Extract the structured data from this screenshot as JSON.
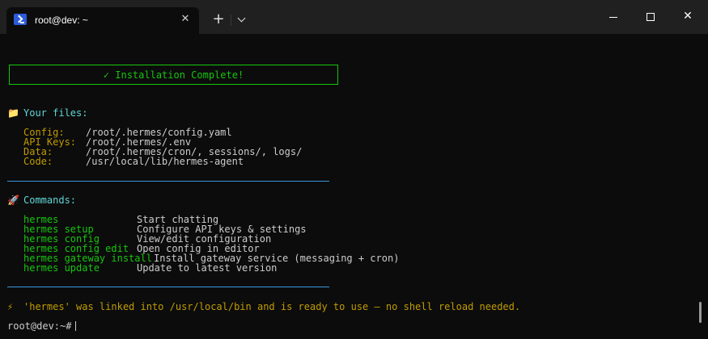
{
  "window": {
    "tab_title": "root@dev: ~",
    "tab_close": "✕",
    "new_tab": "+",
    "close_glyph": "✕"
  },
  "terminal": {
    "banner": "✓ Installation Complete!",
    "files": {
      "icon": "📁",
      "header": "Your files:",
      "rows": [
        {
          "label": "Config:",
          "value": "/root/.hermes/config.yaml"
        },
        {
          "label": "API Keys:",
          "value": "/root/.hermes/.env"
        },
        {
          "label": "Data:",
          "value": "/root/.hermes/cron/, sessions/, logs/"
        },
        {
          "label": "Code:",
          "value": "/usr/local/lib/hermes-agent"
        }
      ]
    },
    "commands": {
      "icon": "🚀",
      "header": "Commands:",
      "rows": [
        {
          "cmd": "hermes",
          "desc": "Start chatting"
        },
        {
          "cmd": "hermes setup",
          "desc": "Configure API keys & settings"
        },
        {
          "cmd": "hermes config",
          "desc": "View/edit configuration"
        },
        {
          "cmd": "hermes config edit",
          "desc": "Open config in editor"
        },
        {
          "cmd": "hermes gateway install",
          "desc": "Install gateway service (messaging + cron)"
        },
        {
          "cmd": "hermes update",
          "desc": "Update to latest version"
        }
      ]
    },
    "note": {
      "icon": "⚡",
      "text": "'hermes' was linked into /usr/local/bin and is ready to use — no shell reload needed."
    },
    "prompt": "root@dev:~#"
  },
  "colors": {
    "background": "#0c0c0c",
    "titlebar": "#202020",
    "green": "#16c60c",
    "cyan": "#61d6d6",
    "yellow": "#c19c00",
    "blue": "#3a96dd",
    "text": "#cccccc"
  },
  "icons": {
    "tab": "terminal-icon",
    "new_tab": "plus-icon",
    "dropdown": "chevron-down-icon",
    "minimize": "minimize-icon",
    "maximize": "maximize-icon",
    "close": "close-icon",
    "files": "folder-icon",
    "commands": "rocket-icon",
    "note": "lightning-icon"
  }
}
